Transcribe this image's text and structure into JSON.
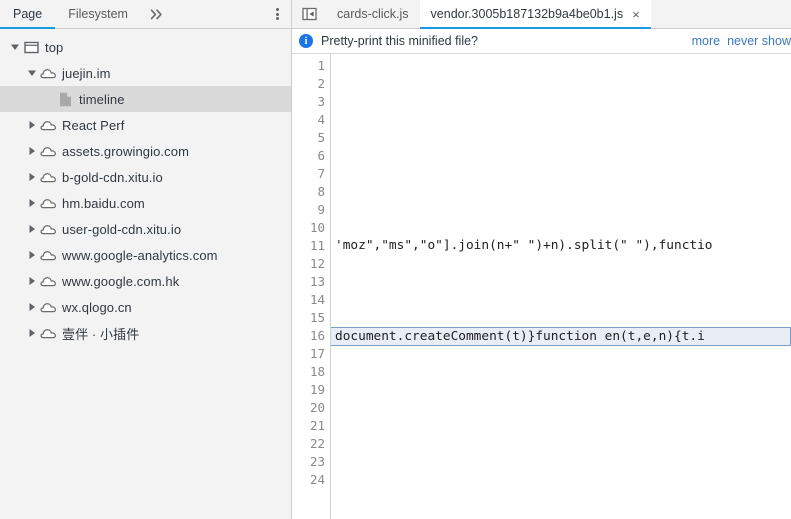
{
  "sidebar": {
    "tabs": [
      {
        "label": "Page",
        "active": true
      },
      {
        "label": "Filesystem",
        "active": false
      }
    ],
    "overflow_icon": "double-chevron-right-icon",
    "menu_icon": "kebab-menu-icon",
    "tree": [
      {
        "label": "top",
        "icon": "frame-icon",
        "depth": 0,
        "twisty": "expanded",
        "selected": false
      },
      {
        "label": "juejin.im",
        "icon": "cloud-icon",
        "depth": 1,
        "twisty": "expanded",
        "selected": false
      },
      {
        "label": "timeline",
        "icon": "file-icon",
        "depth": 2,
        "twisty": "none",
        "selected": true
      },
      {
        "label": "React Perf",
        "icon": "cloud-icon",
        "depth": 1,
        "twisty": "collapsed",
        "selected": false
      },
      {
        "label": "assets.growingio.com",
        "icon": "cloud-icon",
        "depth": 1,
        "twisty": "collapsed",
        "selected": false
      },
      {
        "label": "b-gold-cdn.xitu.io",
        "icon": "cloud-icon",
        "depth": 1,
        "twisty": "collapsed",
        "selected": false
      },
      {
        "label": "hm.baidu.com",
        "icon": "cloud-icon",
        "depth": 1,
        "twisty": "collapsed",
        "selected": false
      },
      {
        "label": "user-gold-cdn.xitu.io",
        "icon": "cloud-icon",
        "depth": 1,
        "twisty": "collapsed",
        "selected": false
      },
      {
        "label": "www.google-analytics.com",
        "icon": "cloud-icon",
        "depth": 1,
        "twisty": "collapsed",
        "selected": false
      },
      {
        "label": "www.google.com.hk",
        "icon": "cloud-icon",
        "depth": 1,
        "twisty": "collapsed",
        "selected": false
      },
      {
        "label": "wx.qlogo.cn",
        "icon": "cloud-icon",
        "depth": 1,
        "twisty": "collapsed",
        "selected": false
      },
      {
        "label": "壹伴 · 小插件",
        "icon": "cloud-icon",
        "depth": 1,
        "twisty": "collapsed",
        "selected": false
      }
    ]
  },
  "editor": {
    "navigator_icon": "show-navigator-icon",
    "tabs": [
      {
        "label": "cards-click.js",
        "active": false,
        "closable": false
      },
      {
        "label": "vendor.3005b187132b9a4be0b1.js",
        "active": true,
        "closable": true,
        "close_label": "×"
      }
    ],
    "infobar": {
      "icon": "info-circle-icon",
      "message": "Pretty-print this minified file?",
      "links": [
        {
          "label": "more"
        },
        {
          "label": "never show"
        }
      ]
    },
    "line_numbers": [
      1,
      2,
      3,
      4,
      5,
      6,
      7,
      8,
      9,
      10,
      11,
      12,
      13,
      14,
      15,
      16,
      17,
      18,
      19,
      20,
      21,
      22,
      23,
      24
    ],
    "lines": [
      {
        "n": 1,
        "text": "",
        "highlighted": false
      },
      {
        "n": 2,
        "text": "",
        "highlighted": false
      },
      {
        "n": 3,
        "text": "",
        "highlighted": false
      },
      {
        "n": 4,
        "text": "",
        "highlighted": false
      },
      {
        "n": 5,
        "text": "",
        "highlighted": false
      },
      {
        "n": 6,
        "text": "",
        "highlighted": false
      },
      {
        "n": 7,
        "text": "",
        "highlighted": false
      },
      {
        "n": 8,
        "text": "",
        "highlighted": false
      },
      {
        "n": 9,
        "text": "",
        "highlighted": false
      },
      {
        "n": 10,
        "text": "",
        "highlighted": false
      },
      {
        "n": 11,
        "text": "'moz\",\"ms\",\"o\"].join(n+\" \")+n).split(\" \"),functio",
        "highlighted": false
      },
      {
        "n": 12,
        "text": "",
        "highlighted": false
      },
      {
        "n": 13,
        "text": "",
        "highlighted": false
      },
      {
        "n": 14,
        "text": "",
        "highlighted": false
      },
      {
        "n": 15,
        "text": "",
        "highlighted": false
      },
      {
        "n": 16,
        "text": "document.createComment(t)}function en(t,e,n){t.i",
        "highlighted": true
      },
      {
        "n": 17,
        "text": "",
        "highlighted": false
      },
      {
        "n": 18,
        "text": "",
        "highlighted": false
      },
      {
        "n": 19,
        "text": "",
        "highlighted": false
      },
      {
        "n": 20,
        "text": "",
        "highlighted": false
      },
      {
        "n": 21,
        "text": "",
        "highlighted": false
      },
      {
        "n": 22,
        "text": "",
        "highlighted": false
      },
      {
        "n": 23,
        "text": "",
        "highlighted": false
      },
      {
        "n": 24,
        "text": "",
        "highlighted": false
      }
    ]
  },
  "colors": {
    "accent_blue": "#1a9ae0",
    "link_blue": "#3b78c3",
    "info_blue": "#1a73e8",
    "sidebar_bg": "#f3f3f3",
    "selected_row": "#dadada",
    "highlight_line_bg": "#e9eef6",
    "highlight_line_border": "#7a9cc6"
  }
}
